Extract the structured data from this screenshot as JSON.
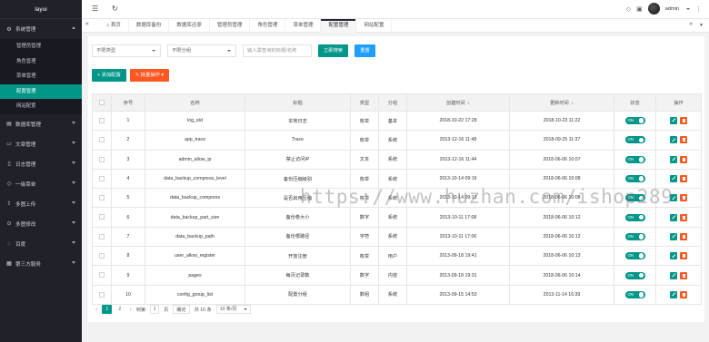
{
  "app": {
    "logo": "layui"
  },
  "sidebar": {
    "groups": [
      {
        "label": "系统管理",
        "icon": "gear-icon",
        "glyph": "⚙",
        "expanded": true,
        "children": [
          "管理员管理",
          "角色管理",
          "菜单管理",
          "配置管理",
          "网站配置"
        ],
        "active_child": 3
      },
      {
        "label": "数据库管理",
        "icon": "database-icon",
        "glyph": "▤"
      },
      {
        "label": "文章管理",
        "icon": "document-icon",
        "glyph": "▭"
      },
      {
        "label": "日志管理",
        "icon": "log-icon",
        "glyph": "▯"
      },
      {
        "label": "一级菜单",
        "icon": "menu-icon",
        "glyph": "◇"
      },
      {
        "label": "多图上传",
        "icon": "upload-icon",
        "glyph": "⇪"
      },
      {
        "label": "多图修改",
        "icon": "edit-icon",
        "glyph": "⊙"
      },
      {
        "label": "百度",
        "icon": "link-icon",
        "glyph": "◌"
      },
      {
        "label": "第三方服务",
        "icon": "service-icon",
        "glyph": "▦"
      }
    ]
  },
  "header": {
    "user": "admin"
  },
  "tabs": [
    {
      "label": "首页"
    },
    {
      "label": "数据库备份"
    },
    {
      "label": "数据库还原"
    },
    {
      "label": "管理员管理"
    },
    {
      "label": "角色管理"
    },
    {
      "label": "菜单管理"
    },
    {
      "label": "配置管理",
      "active": true
    },
    {
      "label": "网站配置"
    }
  ],
  "search": {
    "type_select": "不限类型",
    "group_select": "不限分组",
    "keyword_placeholder": "输入需查询的标题/名称",
    "search_button": "立即搜索",
    "reset_button": "重置"
  },
  "actions": {
    "add_button": "+ 添加配置",
    "batch_button": "✎ 批量操作 ▾"
  },
  "table": {
    "headers": [
      "序号",
      "名称",
      "标题",
      "类型",
      "分组",
      "创建时间",
      "更新时间",
      "状态",
      "操作"
    ],
    "rows": [
      [
        "1",
        "log_std",
        "本地日志",
        "枚举",
        "基本",
        "2018-10-22 17:28",
        "2018-10-23 11:22"
      ],
      [
        "2",
        "app_trace",
        "Trace",
        "枚举",
        "系统",
        "2013-12-16 11:48",
        "2018-09-25 11:37"
      ],
      [
        "3",
        "admin_allow_ip",
        "禁止访问IP",
        "文本",
        "系统",
        "2013-12-16 11:44",
        "2018-06-06 10:07"
      ],
      [
        "4",
        "data_backup_compress_level",
        "备份压缩级别",
        "枚举",
        "系统",
        "2013-10-14 09:16",
        "2018-06-06 10:08"
      ],
      [
        "5",
        "data_backup_compress",
        "是否启用压缩",
        "枚举",
        "系统",
        "2013-10-14 09:13",
        "2018-06-06 10:08"
      ],
      [
        "6",
        "data_backup_part_size",
        "备份卷大小",
        "数字",
        "系统",
        "2013-10-11 17:08",
        "2018-06-06 10:12"
      ],
      [
        "7",
        "data_backup_path",
        "备份根路径",
        "字符",
        "系统",
        "2013-10-11 17:06",
        "2018-06-06 10:12"
      ],
      [
        "8",
        "user_allow_register",
        "开放注册",
        "枚举",
        "用户",
        "2013-09-18 19:41",
        "2018-06-06 10:13"
      ],
      [
        "9",
        "pages",
        "每页记录数",
        "数字",
        "内容",
        "2013-09-18 19:31",
        "2018-06-06 10:14"
      ],
      [
        "10",
        "config_group_list",
        "配置分组",
        "数组",
        "系统",
        "2013-09-15 14:53",
        "2013-11-14 16:39"
      ]
    ],
    "status_label": "ON"
  },
  "pager": {
    "pages": [
      "1",
      "2"
    ],
    "current": "1",
    "goto_label": "到第",
    "goto_value": "1",
    "page_unit": "页",
    "ok_label": "确定",
    "total": "共 16 条",
    "per_page": "10 条/页"
  },
  "watermark": "https://www.huzhan.com/ishop289"
}
